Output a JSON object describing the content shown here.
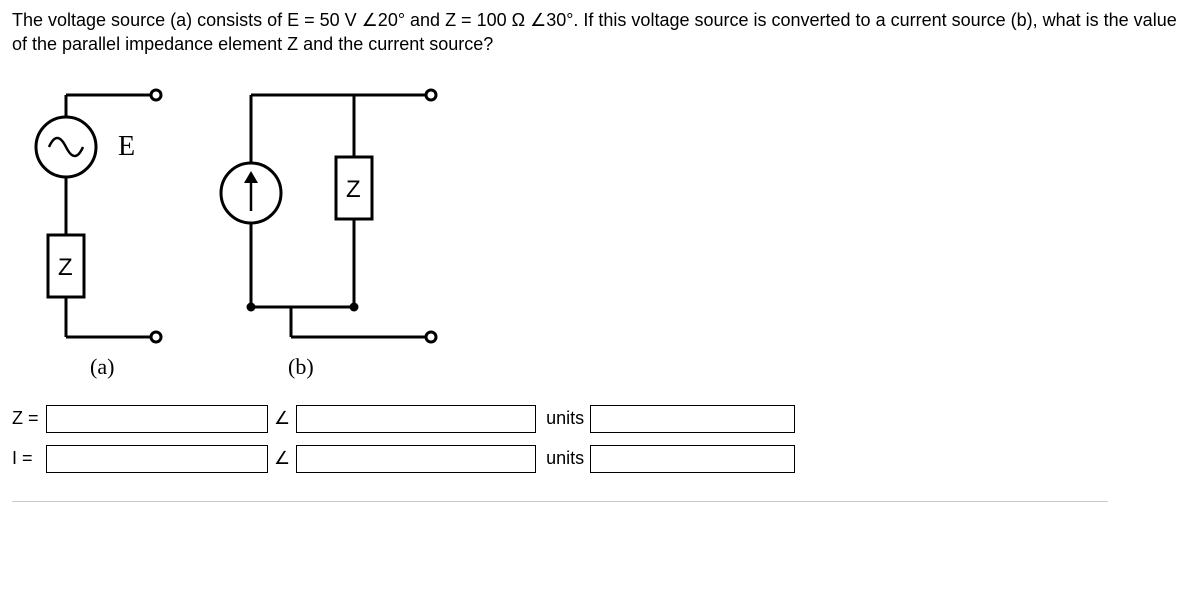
{
  "question": "The voltage source (a) consists of E = 50 V ∠20° and Z = 100 Ω ∠30°. If this voltage source is converted to a current source (b), what is the value of the parallel impedance element Z and the current source?",
  "diagram": {
    "label_E": "E",
    "label_Z_a": "Z",
    "label_Z_b": "Z",
    "caption_a": "(a)",
    "caption_b": "(b)"
  },
  "answers": {
    "Z": {
      "label": "Z =",
      "angle_symbol": "∠",
      "units_label": "units"
    },
    "I": {
      "label": "I =",
      "angle_symbol": "∠",
      "units_label": "units"
    }
  }
}
